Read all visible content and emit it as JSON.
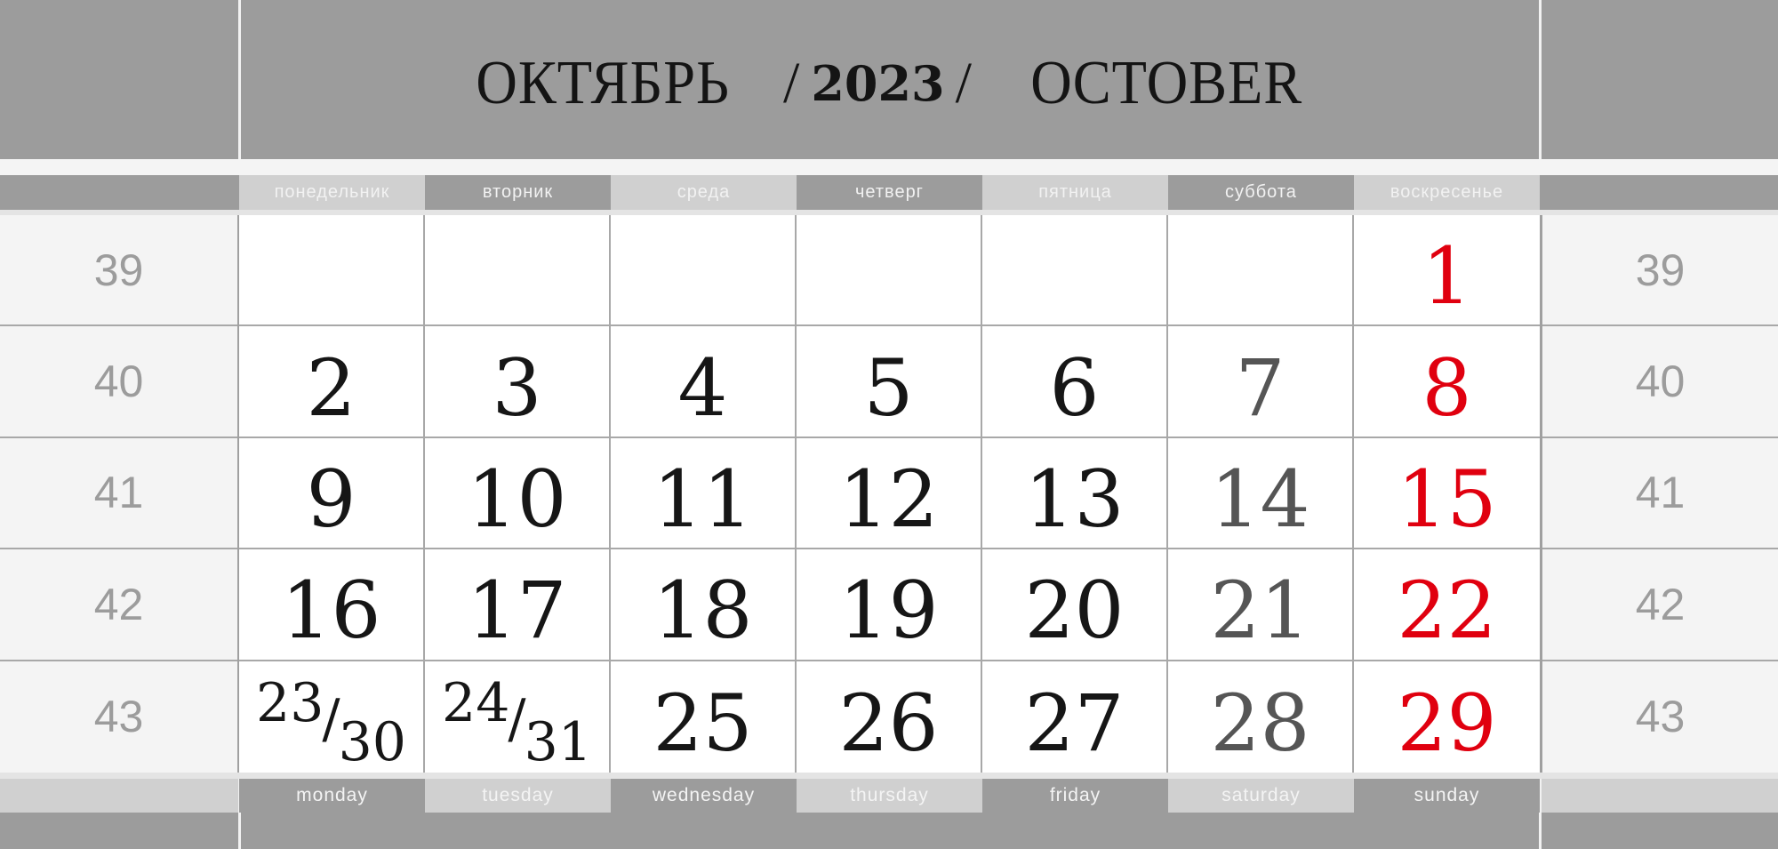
{
  "header": {
    "month_ru": "ОКТЯБРЬ",
    "separator": "/",
    "year": "2023",
    "month_en": "OCTOBER"
  },
  "weekdays_ru": [
    "понедельник",
    "вторник",
    "среда",
    "четверг",
    "пятница",
    "суббота",
    "воскресенье"
  ],
  "weekdays_en": [
    "monday",
    "tuesday",
    "wednesday",
    "thursday",
    "friday",
    "saturday",
    "sunday"
  ],
  "week_numbers": [
    "39",
    "40",
    "41",
    "42",
    "43"
  ],
  "weeks": [
    [
      "",
      "",
      "",
      "",
      "",
      "",
      "1"
    ],
    [
      "2",
      "3",
      "4",
      "5",
      "6",
      "7",
      "8"
    ],
    [
      "9",
      "10",
      "11",
      "12",
      "13",
      "14",
      "15"
    ],
    [
      "16",
      "17",
      "18",
      "19",
      "20",
      "21",
      "22"
    ],
    [
      {
        "top": "23",
        "bottom": "30"
      },
      {
        "top": "24",
        "bottom": "31"
      },
      "25",
      "26",
      "27",
      "28",
      "29"
    ]
  ],
  "colors": {
    "weekday": "#161616",
    "saturday": "#555555",
    "sunday": "#e0000f",
    "band": "#9c9c9c",
    "band_light": "#d0d0d0",
    "week_number": "#9c9c9c"
  }
}
